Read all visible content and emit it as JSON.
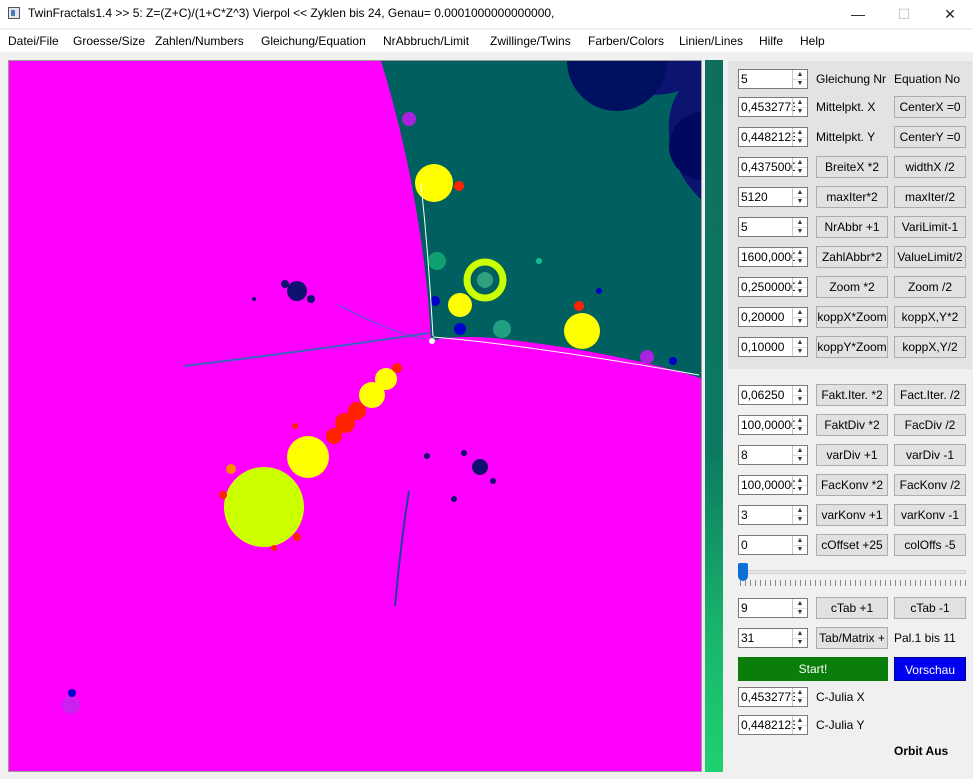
{
  "window": {
    "title": "TwinFractals1.4 >> 5: Z=(Z+C)/(1+C*Z^3) Vierpol << Zyklen bis 24, Genau= 0.0001000000000000,",
    "minimize_glyph": "—",
    "maximize_glyph": "☐",
    "close_glyph": "✕"
  },
  "menu": [
    "Datei/File",
    "Groesse/Size",
    "Zahlen/Numbers",
    "Gleichung/Equation",
    "NrAbbruch/Limit",
    "Zwillinge/Twins",
    "Farben/Colors",
    "Linien/Lines",
    "Hilfe",
    "Help"
  ],
  "fractal_colors": {
    "outer": "#ff00ff",
    "inner": "#006060",
    "deep_blue": "#000066",
    "bulbs": "#ffff00",
    "big_bulb": "#ccff00",
    "red_dots": "#ff2200"
  },
  "params": {
    "equation_nr": {
      "value": "5",
      "label1": "Gleichung Nr",
      "label2": "Equation No"
    },
    "center_x": {
      "value": "0,4532773",
      "label": "Mittelpkt. X",
      "button": "CenterX =0"
    },
    "center_y": {
      "value": "0,4482123",
      "label": "Mittelpkt. Y",
      "button": "CenterY =0"
    },
    "width": {
      "value": "0,4375000",
      "button1": "BreiteX *2",
      "button2": "widthX /2"
    },
    "max_iter": {
      "value": "5120",
      "button1": "maxIter*2",
      "button2": "maxIter/2"
    },
    "nr_abbr": {
      "value": "5",
      "button1": "NrAbbr +1",
      "button2": "VariLimit-1"
    },
    "zahl_abbr": {
      "value": "1600,0000",
      "button1": "ZahlAbbr*2",
      "button2": "ValueLimit/2"
    },
    "zoom": {
      "value": "0,2500000",
      "button1": "Zoom *2",
      "button2": "Zoom /2"
    },
    "kopp_x": {
      "value": "0,20000",
      "button1": "koppX*Zoom",
      "button2": "koppX,Y*2"
    },
    "kopp_y": {
      "value": "0,10000",
      "button1": "koppY*Zoom",
      "button2": "koppX,Y/2"
    },
    "fakt_iter": {
      "value": "0,06250",
      "button1": "Fakt.Iter. *2",
      "button2": "Fact.Iter. /2"
    },
    "fakt_div": {
      "value": "100,00000",
      "button1": "FaktDiv *2",
      "button2": "FacDiv /2"
    },
    "var_div": {
      "value": "8",
      "button1": "varDiv +1",
      "button2": "varDiv -1"
    },
    "fac_konv": {
      "value": "100,00000",
      "button1": "FacKonv *2",
      "button2": "FacKonv /2"
    },
    "var_konv": {
      "value": "3",
      "button1": "varKonv +1",
      "button2": "varKonv -1"
    },
    "c_offset": {
      "value": "0",
      "button1": "cOffset +25",
      "button2": "colOffs -5"
    },
    "c_tab": {
      "value": "9",
      "button1": "cTab +1",
      "button2": "cTab -1"
    },
    "tab_matrix": {
      "value": "31",
      "button1": "Tab/Matrix +",
      "label": "Pal.1 bis 11"
    },
    "c_julia_x": {
      "value": "0,4532773",
      "label": "C-Julia X"
    },
    "c_julia_y": {
      "value": "0,4482123",
      "label": "C-Julia Y"
    }
  },
  "slider": {
    "value": 0
  },
  "actions": {
    "start": "Start!",
    "preview": "Vorschau"
  },
  "status": {
    "orbit": "Orbit Aus"
  },
  "spin_icons": {
    "up": "▲",
    "down": "▼"
  }
}
